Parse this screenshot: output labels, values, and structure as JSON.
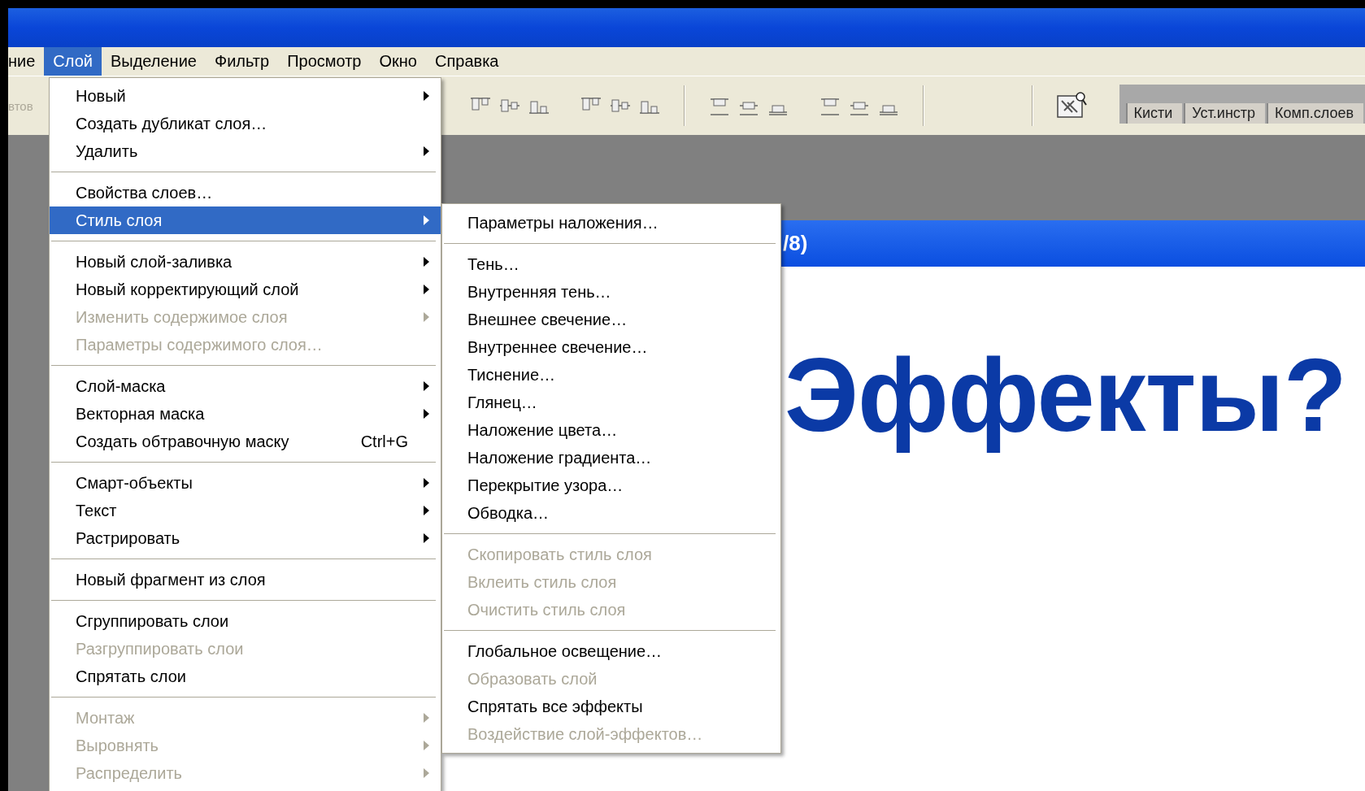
{
  "menubar": {
    "items": [
      {
        "label": "ние",
        "selected": false
      },
      {
        "label": "Слой",
        "selected": true
      },
      {
        "label": "Выделение",
        "selected": false
      },
      {
        "label": "Фильтр",
        "selected": false
      },
      {
        "label": "Просмотр",
        "selected": false
      },
      {
        "label": "Окно",
        "selected": false
      },
      {
        "label": "Справка",
        "selected": false
      }
    ]
  },
  "toolbar": {
    "cut_label": "втов",
    "palette_tabs": [
      "Кисти",
      "Уст.инстр",
      "Комп.слоев"
    ]
  },
  "document": {
    "title": "/8)",
    "canvas_text": "Эффекты?"
  },
  "layer_menu": {
    "items": [
      {
        "kind": "item",
        "label": "Новый",
        "submenu": true,
        "disabled": false,
        "selected": false
      },
      {
        "kind": "item",
        "label": "Создать дубликат слоя…",
        "submenu": false,
        "disabled": false,
        "selected": false
      },
      {
        "kind": "item",
        "label": "Удалить",
        "submenu": true,
        "disabled": false,
        "selected": false
      },
      {
        "kind": "separator"
      },
      {
        "kind": "item",
        "label": "Свойства слоев…",
        "submenu": false,
        "disabled": false,
        "selected": false
      },
      {
        "kind": "item",
        "label": "Стиль слоя",
        "submenu": true,
        "disabled": false,
        "selected": true
      },
      {
        "kind": "separator"
      },
      {
        "kind": "item",
        "label": "Новый слой-заливка",
        "submenu": true,
        "disabled": false,
        "selected": false
      },
      {
        "kind": "item",
        "label": "Новый корректирующий слой",
        "submenu": true,
        "disabled": false,
        "selected": false
      },
      {
        "kind": "item",
        "label": "Изменить содержимое слоя",
        "submenu": true,
        "disabled": true,
        "selected": false
      },
      {
        "kind": "item",
        "label": "Параметры содержимого слоя…",
        "submenu": false,
        "disabled": true,
        "selected": false
      },
      {
        "kind": "separator"
      },
      {
        "kind": "item",
        "label": "Слой-маска",
        "submenu": true,
        "disabled": false,
        "selected": false
      },
      {
        "kind": "item",
        "label": "Векторная маска",
        "submenu": true,
        "disabled": false,
        "selected": false
      },
      {
        "kind": "item",
        "label": "Создать обтравочную маску",
        "shortcut": "Ctrl+G",
        "submenu": false,
        "disabled": false,
        "selected": false
      },
      {
        "kind": "separator"
      },
      {
        "kind": "item",
        "label": "Смарт-объекты",
        "submenu": true,
        "disabled": false,
        "selected": false
      },
      {
        "kind": "item",
        "label": "Текст",
        "submenu": true,
        "disabled": false,
        "selected": false
      },
      {
        "kind": "item",
        "label": "Растрировать",
        "submenu": true,
        "disabled": false,
        "selected": false
      },
      {
        "kind": "separator"
      },
      {
        "kind": "item",
        "label": "Новый фрагмент из слоя",
        "submenu": false,
        "disabled": false,
        "selected": false
      },
      {
        "kind": "separator"
      },
      {
        "kind": "item",
        "label": "Сгруппировать слои",
        "submenu": false,
        "disabled": false,
        "selected": false
      },
      {
        "kind": "item",
        "label": "Разгруппировать слои",
        "submenu": false,
        "disabled": true,
        "selected": false
      },
      {
        "kind": "item",
        "label": "Спрятать слои",
        "submenu": false,
        "disabled": false,
        "selected": false
      },
      {
        "kind": "separator"
      },
      {
        "kind": "item",
        "label": "Монтаж",
        "submenu": true,
        "disabled": true,
        "selected": false
      },
      {
        "kind": "item",
        "label": "Выровнять",
        "submenu": true,
        "disabled": true,
        "selected": false
      },
      {
        "kind": "item",
        "label": "Распределить",
        "submenu": true,
        "disabled": true,
        "selected": false
      }
    ]
  },
  "layer_style_submenu": {
    "items": [
      {
        "kind": "item",
        "label": "Параметры наложения…",
        "submenu": false,
        "disabled": false,
        "selected": false
      },
      {
        "kind": "separator"
      },
      {
        "kind": "item",
        "label": "Тень…",
        "submenu": false,
        "disabled": false,
        "selected": false
      },
      {
        "kind": "item",
        "label": "Внутренняя тень…",
        "submenu": false,
        "disabled": false,
        "selected": false
      },
      {
        "kind": "item",
        "label": "Внешнее свечение…",
        "submenu": false,
        "disabled": false,
        "selected": false
      },
      {
        "kind": "item",
        "label": "Внутреннее свечение…",
        "submenu": false,
        "disabled": false,
        "selected": false
      },
      {
        "kind": "item",
        "label": "Тиснение…",
        "submenu": false,
        "disabled": false,
        "selected": false
      },
      {
        "kind": "item",
        "label": "Глянец…",
        "submenu": false,
        "disabled": false,
        "selected": false
      },
      {
        "kind": "item",
        "label": "Наложение цвета…",
        "submenu": false,
        "disabled": false,
        "selected": false
      },
      {
        "kind": "item",
        "label": "Наложение градиента…",
        "submenu": false,
        "disabled": false,
        "selected": false
      },
      {
        "kind": "item",
        "label": "Перекрытие узора…",
        "submenu": false,
        "disabled": false,
        "selected": false
      },
      {
        "kind": "item",
        "label": "Обводка…",
        "submenu": false,
        "disabled": false,
        "selected": false
      },
      {
        "kind": "separator"
      },
      {
        "kind": "item",
        "label": "Скопировать стиль слоя",
        "submenu": false,
        "disabled": true,
        "selected": false
      },
      {
        "kind": "item",
        "label": "Вклеить стиль слоя",
        "submenu": false,
        "disabled": true,
        "selected": false
      },
      {
        "kind": "item",
        "label": "Очистить стиль слоя",
        "submenu": false,
        "disabled": true,
        "selected": false
      },
      {
        "kind": "separator"
      },
      {
        "kind": "item",
        "label": "Глобальное освещение…",
        "submenu": false,
        "disabled": false,
        "selected": false
      },
      {
        "kind": "item",
        "label": "Образовать слой",
        "submenu": false,
        "disabled": true,
        "selected": false
      },
      {
        "kind": "item",
        "label": "Спрятать все эффекты",
        "submenu": false,
        "disabled": false,
        "selected": false
      },
      {
        "kind": "item",
        "label": "Воздействие слой-эффектов…",
        "submenu": false,
        "disabled": true,
        "selected": false
      }
    ]
  }
}
